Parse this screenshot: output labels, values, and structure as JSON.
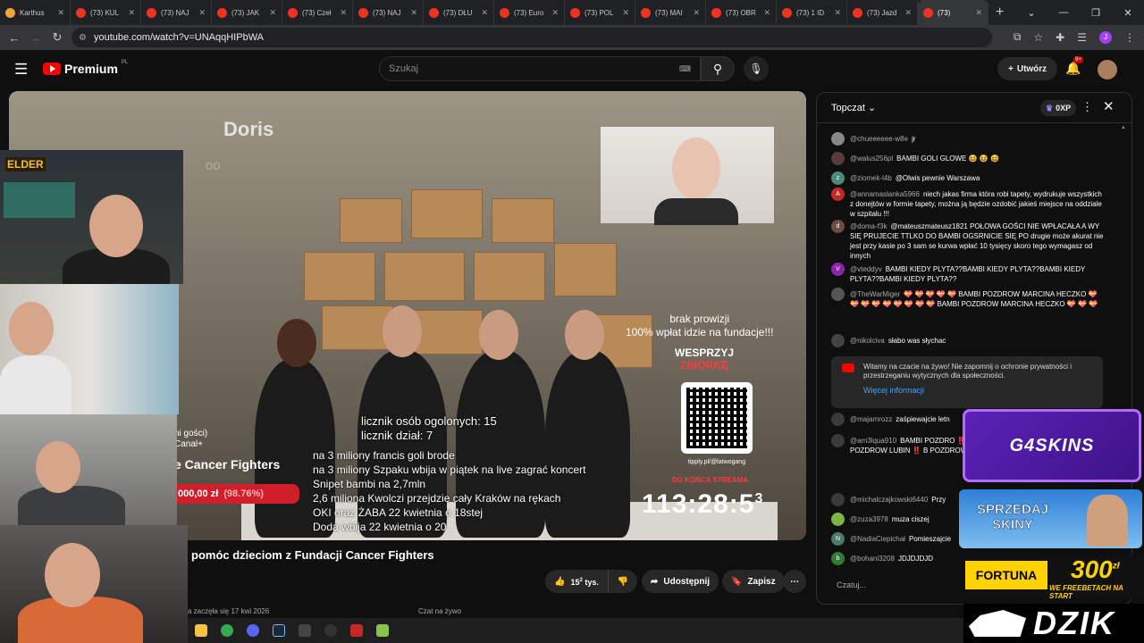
{
  "browser": {
    "tabs": [
      {
        "label": "Karthus",
        "icon": "karthus-favicon"
      },
      {
        "label": "(73) KUL",
        "icon": "youtube-favicon"
      },
      {
        "label": "(73) NAJ",
        "icon": "youtube-favicon"
      },
      {
        "label": "(73) JAK",
        "icon": "youtube-favicon"
      },
      {
        "label": "(73) Czeł",
        "icon": "youtube-favicon"
      },
      {
        "label": "(73) NAJ",
        "icon": "youtube-favicon"
      },
      {
        "label": "(73) DŁU",
        "icon": "youtube-favicon"
      },
      {
        "label": "(73) Euro",
        "icon": "youtube-favicon"
      },
      {
        "label": "(73) POL",
        "icon": "youtube-favicon"
      },
      {
        "label": "(73) MAI",
        "icon": "youtube-favicon"
      },
      {
        "label": "(73) OBR",
        "icon": "youtube-favicon"
      },
      {
        "label": "(73) 1 ID",
        "icon": "youtube-favicon"
      },
      {
        "label": "(73) Jazd",
        "icon": "youtube-favicon"
      },
      {
        "label": "(73)",
        "icon": "youtube-favicon",
        "active": true
      }
    ],
    "url": "youtube.com/watch?v=UNAqqHIPbWA",
    "profile_letter": "J"
  },
  "yt": {
    "logo": "Premium",
    "region": "PL",
    "search_placeholder": "Szukaj",
    "create_label": "Utwórz",
    "notif_count": "9+"
  },
  "video": {
    "title": "pomóc dzieciom z Fundacji Cancer Fighters",
    "overlay": {
      "doris": "Doris",
      "doris_sub": "oo",
      "no_fee": "brak prowizji",
      "all_to_foundation": "100% wpłat idzie na fundacje!!!",
      "support": "WESPRZYJ",
      "fundraiser": "ZBIÓRKĘ",
      "tipply": "tipply.pl/@latwogang",
      "until_end": "DO KOŃCA STREAMA",
      "timer": "113:28:5",
      "timer_sup": "3",
      "counter_people": "licznik osób ogolonych: 15",
      "counter_shares": "licznik dział: 7",
      "goals": [
        "na 3 miliony francis goli brode",
        "na 3 miliony Szpaku wbija w piątek na live zagrać koncert",
        "Snipet bambi na 2,7mln",
        "2,6 miliona Kwolczi przejdzie cały Kraków na rękach",
        "OKI oraz ŻABA 22 kwietnia o 18stej",
        "Doda wbija 22 kwietnia o 20"
      ],
      "goal_left_1": "ni gości)",
      "goal_left_2": "Canal+",
      "goal_name": "e Cancer Fighters",
      "goal_amount": "000,00 zł",
      "goal_pct": "(98.76%)"
    },
    "cam_logo": "ELDER",
    "likes": "15",
    "likes_sup": "2",
    "likes_unit": "tys.",
    "share_label": "Udostępnij",
    "save_label": "Zapisz",
    "started": "a zaczęła się 17 kwi 2026",
    "live_chat_label": "Czat na żywo"
  },
  "chat": {
    "header": "Topczat",
    "xp": "0XP",
    "input_placeholder": "Czatuj...",
    "messages": [
      {
        "author": "@chueeeeee-w8e",
        "text": "jr",
        "avatar_color": "#888"
      },
      {
        "author": "@walus256pl",
        "text": "BAMBI GOLI GLOWE 😆 😆 😆",
        "avatar_color": "#5a3a3a"
      },
      {
        "author": "@ziomek-l4b",
        "text": "@Olwis pewnie Warszawa",
        "avatar_color": "#4a8a7a",
        "initial": "z"
      },
      {
        "author": "@annamaslanka5966",
        "text": "niech jakas firma która robi tapety, wydrukuje wszystkich z donejtów w formie tapety, można ją będzie ozdobić jakieś miejsce na oddziale w szpitalu !!!",
        "avatar_color": "#c62828",
        "initial": "A"
      },
      {
        "author": "@doma-f3k",
        "text": "@mateuszmateusz1821 POŁOWA GOŚCI NIE WPŁACAŁA A WY SIĘ PRUJECIE TTLKO DO BAMBI OGSRNICIE SIĘ PO drugie może akurat nie jest przy kasie po 3 sam se kurwa wpłać 10 tysięcy skoro tego wymagasz od innych",
        "avatar_color": "#6d4c41",
        "initial": "d"
      },
      {
        "author": "@vteddyv",
        "text": "BAMBI KIEDY PLYTA??BAMBI KIEDY PLYTA??BAMBI KIEDY PLYTA??BAMBI KIEDY PLYTA??",
        "avatar_color": "#8e24aa",
        "initial": "V"
      },
      {
        "author": "@TheWarMiger",
        "text": "💝 💝 💝 💝 💝 BAMBI POZDROW MARCINA HECZKO 💝 💝 💝 💝 💝 💝 💝 💝 💝 BAMBI POZDROW MARCINA HECZKO 💝 💝 💝",
        "avatar_color": "#555"
      },
      {
        "author": "@nikolciva",
        "text": "słabo was słychac",
        "avatar_color": "#444"
      },
      {
        "author": "@majamrozz",
        "text": "zaśpiewajcie letn",
        "avatar_color": "#3a3a3a"
      },
      {
        "author": "@am3lqua910",
        "text": "BAMBI POZDRO ‼️ BAMBI POZDROW LUBIN BAMBI POZDROW LUBIN ‼️ B POZDROW LUBIN ‼️",
        "avatar_color": "#3a3a3a"
      },
      {
        "author": "@michalczajkowski6440",
        "text": "Przy",
        "avatar_color": "#3a3a3a"
      },
      {
        "author": "@zuza3978",
        "text": "muza ciszej",
        "avatar_color": "#7cb342"
      },
      {
        "author": "@NadiaCiepichał",
        "text": "Pomieszajcie",
        "avatar_color": "#4a7a6a",
        "initial": "N"
      },
      {
        "author": "@bohani3208",
        "text": "JDJDJDJD",
        "avatar_color": "#2e7d32",
        "initial": "b"
      }
    ],
    "notice_text": "Witamy na czacie na żywo! Nie zapomnij o ochronie prywatności i przestrzeganiu wytycznych dla społeczności.",
    "notice_more": "Więcej informacji"
  },
  "ads": {
    "g4": "G4SKINS",
    "sprzedaj_1": "SPRZEDAJ",
    "sprzedaj_2": "SKINY",
    "fortuna": "FORTUNA",
    "fortuna_amount": "300",
    "fortuna_unit": "zł",
    "fortuna_sub": "WE FREEBETACH NA START",
    "dzik": "DZIK"
  },
  "colors": {
    "yt_red": "#ff0000",
    "link_blue": "#3ea6ff",
    "g4_purple": "#5b22b8",
    "fortuna_yellow": "#ffd200"
  }
}
